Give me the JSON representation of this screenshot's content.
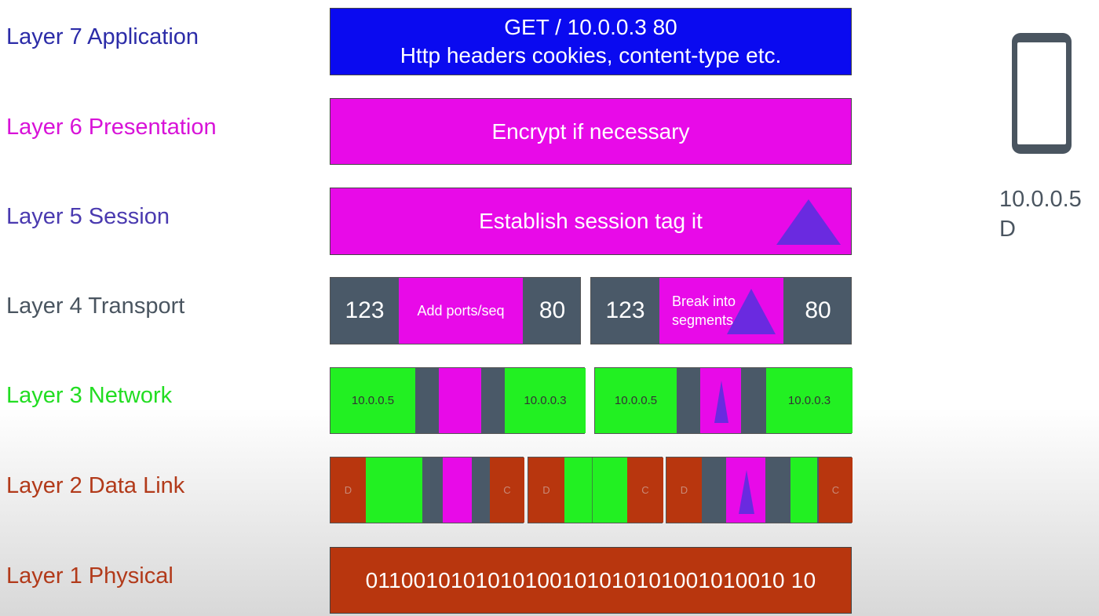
{
  "layers": [
    {
      "label": "Layer 7 Application",
      "color": "#2c2ca8"
    },
    {
      "label": "Layer 6 Presentation",
      "color": "#d812d8"
    },
    {
      "label": "Layer 5 Session",
      "color": "#4a3ab0"
    },
    {
      "label": "Layer 4 Transport",
      "color": "#4a5560"
    },
    {
      "label": "Layer 3 Network",
      "color": "#22dd22"
    },
    {
      "label": "Layer 2 Data Link",
      "color": "#b23a1a"
    },
    {
      "label": "Layer 1 Physical",
      "color": "#b23a1a"
    }
  ],
  "app_box": {
    "line1": "GET / 10.0.0.3 80",
    "line2": "Http headers cookies, content-type etc.",
    "color": "#0a0af0"
  },
  "presentation_box": {
    "text": "Encrypt if necessary",
    "color": "#e80ae8"
  },
  "session_box": {
    "text": "Establish session tag it",
    "color": "#e80ae8"
  },
  "transport": {
    "seg1": {
      "src_port": "123",
      "text": "Add ports/seq",
      "dst_port": "80"
    },
    "seg2": {
      "src_port": "123",
      "text_line1": "Break into",
      "text_line2": "segments",
      "dst_port": "80"
    }
  },
  "network": {
    "pkt1": {
      "src_ip": "10.0.0.5",
      "dst_ip": "10.0.0.3"
    },
    "pkt2": {
      "src_ip": "10.0.0.5",
      "dst_ip": "10.0.0.3"
    }
  },
  "datalink": {
    "f1": {
      "src": "D",
      "dst": "C"
    },
    "f2": {
      "src": "D",
      "dst": "C"
    },
    "f3": {
      "src": "D",
      "dst": "C"
    }
  },
  "physical": {
    "bits": "0110010101010100101010101001010010 10"
  },
  "device": {
    "ip": "10.0.0.5",
    "label": "D"
  },
  "colors": {
    "magenta": "#e80ae8",
    "slate": "#4a5968",
    "green": "#22f022",
    "rust": "#b8360e",
    "triangle": "#6a2ae0",
    "blue": "#0a0af0"
  }
}
